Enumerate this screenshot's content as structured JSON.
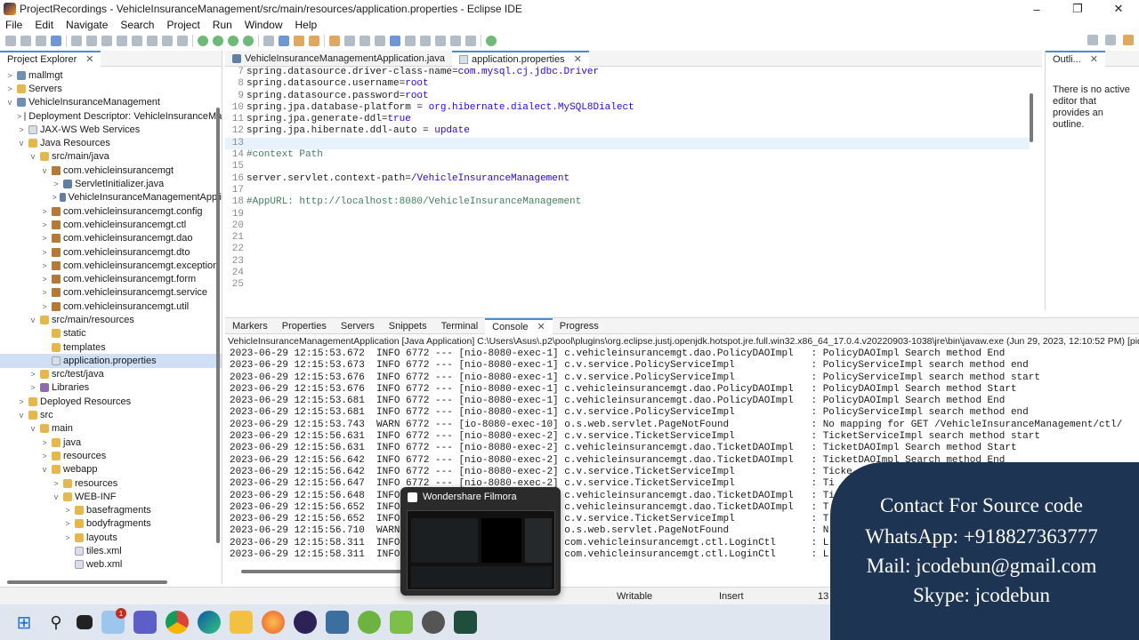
{
  "window": {
    "title": "ProjectRecordings - VehicleInsuranceManagement/src/main/resources/application.properties - Eclipse IDE"
  },
  "menu": [
    "File",
    "Edit",
    "Navigate",
    "Search",
    "Project",
    "Run",
    "Window",
    "Help"
  ],
  "explorer": {
    "tab": "Project Explorer",
    "items": [
      {
        "label": "mallmgt",
        "depth": 0,
        "icon": "project-icon",
        "twisty": ">"
      },
      {
        "label": "Servers",
        "depth": 0,
        "icon": "folder-icon",
        "twisty": ">"
      },
      {
        "label": "VehicleInsuranceManagement",
        "depth": 0,
        "icon": "project-icon",
        "twisty": "v"
      },
      {
        "label": "Deployment Descriptor: VehicleInsuranceMa",
        "depth": 1,
        "icon": "file-icon",
        "twisty": ">"
      },
      {
        "label": "JAX-WS Web Services",
        "depth": 1,
        "icon": "file-icon",
        "twisty": ">"
      },
      {
        "label": "Java Resources",
        "depth": 1,
        "icon": "folder-icon",
        "twisty": "v"
      },
      {
        "label": "src/main/java",
        "depth": 2,
        "icon": "folder-icon",
        "twisty": "v"
      },
      {
        "label": "com.vehicleinsurancemgt",
        "depth": 3,
        "icon": "package-icon",
        "twisty": "v"
      },
      {
        "label": "ServletInitializer.java",
        "depth": 4,
        "icon": "java-file-icon",
        "twisty": ">"
      },
      {
        "label": "VehicleInsuranceManagementAppli",
        "depth": 4,
        "icon": "java-file-icon",
        "twisty": ">"
      },
      {
        "label": "com.vehicleinsurancemgt.config",
        "depth": 3,
        "icon": "package-icon",
        "twisty": ">"
      },
      {
        "label": "com.vehicleinsurancemgt.ctl",
        "depth": 3,
        "icon": "package-icon",
        "twisty": ">"
      },
      {
        "label": "com.vehicleinsurancemgt.dao",
        "depth": 3,
        "icon": "package-icon",
        "twisty": ">"
      },
      {
        "label": "com.vehicleinsurancemgt.dto",
        "depth": 3,
        "icon": "package-icon",
        "twisty": ">"
      },
      {
        "label": "com.vehicleinsurancemgt.exception",
        "depth": 3,
        "icon": "package-icon",
        "twisty": ">"
      },
      {
        "label": "com.vehicleinsurancemgt.form",
        "depth": 3,
        "icon": "package-icon",
        "twisty": ">"
      },
      {
        "label": "com.vehicleinsurancemgt.service",
        "depth": 3,
        "icon": "package-icon",
        "twisty": ">"
      },
      {
        "label": "com.vehicleinsurancemgt.util",
        "depth": 3,
        "icon": "package-icon",
        "twisty": ">"
      },
      {
        "label": "src/main/resources",
        "depth": 2,
        "icon": "folder-icon",
        "twisty": "v"
      },
      {
        "label": "static",
        "depth": 3,
        "icon": "folder-icon",
        "twisty": ""
      },
      {
        "label": "templates",
        "depth": 3,
        "icon": "folder-icon",
        "twisty": ""
      },
      {
        "label": "application.properties",
        "depth": 3,
        "icon": "file-icon",
        "twisty": "",
        "selected": true
      },
      {
        "label": "src/test/java",
        "depth": 2,
        "icon": "folder-icon",
        "twisty": ">"
      },
      {
        "label": "Libraries",
        "depth": 2,
        "icon": "library-icon",
        "twisty": ">"
      },
      {
        "label": "Deployed Resources",
        "depth": 1,
        "icon": "folder-icon",
        "twisty": ">"
      },
      {
        "label": "src",
        "depth": 1,
        "icon": "folder-icon",
        "twisty": "v"
      },
      {
        "label": "main",
        "depth": 2,
        "icon": "folder-icon",
        "twisty": "v"
      },
      {
        "label": "java",
        "depth": 3,
        "icon": "folder-icon",
        "twisty": ">"
      },
      {
        "label": "resources",
        "depth": 3,
        "icon": "folder-icon",
        "twisty": ">"
      },
      {
        "label": "webapp",
        "depth": 3,
        "icon": "folder-icon",
        "twisty": "v"
      },
      {
        "label": "resources",
        "depth": 4,
        "icon": "folder-icon",
        "twisty": ">"
      },
      {
        "label": "WEB-INF",
        "depth": 4,
        "icon": "folder-icon",
        "twisty": "v"
      },
      {
        "label": "basefragments",
        "depth": 5,
        "icon": "folder-icon",
        "twisty": ">"
      },
      {
        "label": "bodyfragments",
        "depth": 5,
        "icon": "folder-icon",
        "twisty": ">"
      },
      {
        "label": "layouts",
        "depth": 5,
        "icon": "folder-icon",
        "twisty": ">"
      },
      {
        "label": "tiles.xml",
        "depth": 5,
        "icon": "file-icon",
        "twisty": ""
      },
      {
        "label": "web.xml",
        "depth": 5,
        "icon": "file-icon",
        "twisty": ""
      }
    ]
  },
  "editor": {
    "tabs": [
      {
        "label": "VehicleInsuranceManagementApplication.java",
        "active": false
      },
      {
        "label": "application.properties",
        "active": true
      }
    ],
    "lines": [
      {
        "n": "7",
        "key": "spring.datasource.driver-class-name=",
        "val": "com.mysql.cj.jdbc.Driver",
        "type": "prop"
      },
      {
        "n": "8",
        "key": "spring.datasource.username=",
        "val": "root",
        "type": "prop"
      },
      {
        "n": "9",
        "key": "spring.datasource.password=",
        "val": "root",
        "type": "prop"
      },
      {
        "n": "10",
        "key": "spring.jpa.database-platform = ",
        "val": "org.hibernate.dialect.MySQL8Dialect",
        "type": "prop"
      },
      {
        "n": "11",
        "key": "spring.jpa.generate-ddl=",
        "val": "true",
        "type": "prop"
      },
      {
        "n": "12",
        "key": "spring.jpa.hibernate.ddl-auto = ",
        "val": "update",
        "type": "prop"
      },
      {
        "n": "13",
        "key": "",
        "val": "",
        "type": "cur"
      },
      {
        "n": "14",
        "key": "#context Path",
        "val": "",
        "type": "comment"
      },
      {
        "n": "15",
        "key": "",
        "val": "",
        "type": "blank"
      },
      {
        "n": "16",
        "key": "server.servlet.context-path=",
        "val": "/VehicleInsuranceManagement",
        "type": "prop"
      },
      {
        "n": "17",
        "key": "",
        "val": "",
        "type": "blank"
      },
      {
        "n": "18",
        "key": "#AppURL: http://localhost:8080/VehicleInsuranceManagement",
        "val": "",
        "type": "comment"
      },
      {
        "n": "19",
        "key": "",
        "val": "",
        "type": "blank"
      },
      {
        "n": "20",
        "key": "",
        "val": "",
        "type": "blank"
      },
      {
        "n": "21",
        "key": "",
        "val": "",
        "type": "blank"
      },
      {
        "n": "22",
        "key": "",
        "val": "",
        "type": "blank"
      },
      {
        "n": "23",
        "key": "",
        "val": "",
        "type": "blank"
      },
      {
        "n": "24",
        "key": "",
        "val": "",
        "type": "blank"
      },
      {
        "n": "25",
        "key": "",
        "val": "",
        "type": "blank"
      }
    ]
  },
  "outline": {
    "tab": "Outli...",
    "message": "There is no active editor that provides an outline."
  },
  "console_tabs": [
    "Markers",
    "Properties",
    "Servers",
    "Snippets",
    "Terminal",
    "Console",
    "Progress"
  ],
  "console": {
    "launch": "VehicleInsuranceManagementApplication [Java Application] C:\\Users\\Asus\\.p2\\pool\\plugins\\org.eclipse.justj.openjdk.hotspot.jre.full.win32.x86_64_17.0.4.v20220903-1038\\jre\\bin\\javaw.exe  (Jun 29, 2023, 12:10:52 PM) [pid: 6772]",
    "rows": [
      "2023-06-29 12:15:53.672  INFO 6772 --- [nio-8080-exec-1] c.vehicleinsurancemgt.dao.PolicyDAOImpl   : PolicyDAOImpl Search method End",
      "2023-06-29 12:15:53.673  INFO 6772 --- [nio-8080-exec-1] c.v.service.PolicyServiceImpl             : PolicyServiceImpl search method end",
      "2023-06-29 12:15:53.676  INFO 6772 --- [nio-8080-exec-1] c.v.service.PolicyServiceImpl             : PolicyServiceImpl search method start",
      "2023-06-29 12:15:53.676  INFO 6772 --- [nio-8080-exec-1] c.vehicleinsurancemgt.dao.PolicyDAOImpl   : PolicyDAOImpl Search method Start",
      "2023-06-29 12:15:53.681  INFO 6772 --- [nio-8080-exec-1] c.vehicleinsurancemgt.dao.PolicyDAOImpl   : PolicyDAOImpl Search method End",
      "2023-06-29 12:15:53.681  INFO 6772 --- [nio-8080-exec-1] c.v.service.PolicyServiceImpl             : PolicyServiceImpl search method end",
      "2023-06-29 12:15:53.743  WARN 6772 --- [io-8080-exec-10] o.s.web.servlet.PageNotFound              : No mapping for GET /VehicleInsuranceManagement/ctl/",
      "2023-06-29 12:15:56.631  INFO 6772 --- [nio-8080-exec-2] c.v.service.TicketServiceImpl             : TicketServiceImpl search method start",
      "2023-06-29 12:15:56.631  INFO 6772 --- [nio-8080-exec-2] c.vehicleinsurancemgt.dao.TicketDAOImpl   : TicketDAOImpl Search method Start",
      "2023-06-29 12:15:56.642  INFO 6772 --- [nio-8080-exec-2] c.vehicleinsurancemgt.dao.TicketDAOImpl   : TicketDAOImpl Search method End",
      "2023-06-29 12:15:56.642  INFO 6772 --- [nio-8080-exec-2] c.v.service.TicketServiceImpl             : Ticke",
      "2023-06-29 12:15:56.647  INFO 6772 --- [nio-8080-exec-2] c.v.service.TicketServiceImpl             : Ti",
      "2023-06-29 12:15:56.648  INFO                            c.vehicleinsurancemgt.dao.TicketDAOImpl   : Ti",
      "2023-06-29 12:15:56.652  INFO                            c.vehicleinsurancemgt.dao.TicketDAOImpl   : T",
      "2023-06-29 12:15:56.652  INFO                            c.v.service.TicketServiceImpl             : T",
      "2023-06-29 12:15:56.710  WARN                            o.s.web.servlet.PageNotFound              : N",
      "2023-06-29 12:15:58.311  INFO                            com.vehicleinsurancemgt.ctl.LoginCtl      : L",
      "2023-06-29 12:15:58.311  INFO                            com.vehicleinsurancemgt.ctl.LoginCtl      : L"
    ]
  },
  "statusbar": {
    "writable": "Writable",
    "insert": "Insert",
    "position": "13"
  },
  "popup": {
    "title": "Wondershare Filmora"
  },
  "overlay": {
    "line1": "Contact For Source code",
    "line2": "WhatsApp:   +918827363777",
    "line3": "Mail: jcodebun@gmail.com",
    "line4": "Skype: jcodebun"
  },
  "taskbar": {
    "badge": "1"
  }
}
